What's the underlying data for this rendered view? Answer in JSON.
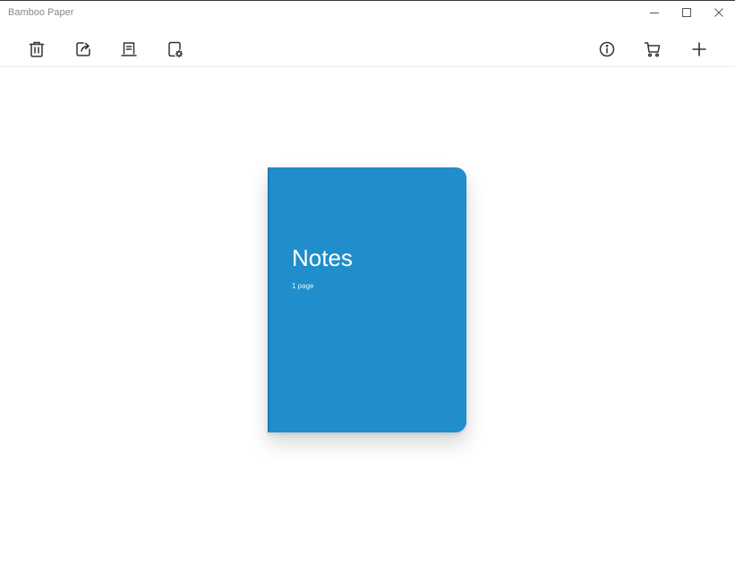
{
  "window": {
    "title": "Bamboo Paper",
    "controls": {
      "minimize": "minimize-icon",
      "maximize": "maximize-icon",
      "close": "close-icon"
    }
  },
  "toolbar": {
    "left_tools": [
      {
        "name": "delete",
        "icon": "trash-icon"
      },
      {
        "name": "share",
        "icon": "share-icon"
      },
      {
        "name": "edit",
        "icon": "edit-icon"
      },
      {
        "name": "settings",
        "icon": "notebook-settings-icon"
      }
    ],
    "right_tools": [
      {
        "name": "info",
        "icon": "info-icon"
      },
      {
        "name": "store",
        "icon": "cart-icon"
      },
      {
        "name": "add",
        "icon": "plus-icon"
      }
    ]
  },
  "notebooks": [
    {
      "title": "Notes",
      "pages": "1 page",
      "cover_color": "#1f8ecb"
    }
  ],
  "colors": {
    "icon": "#333333",
    "cover": "#1f8ecb",
    "background": "#ffffff"
  }
}
